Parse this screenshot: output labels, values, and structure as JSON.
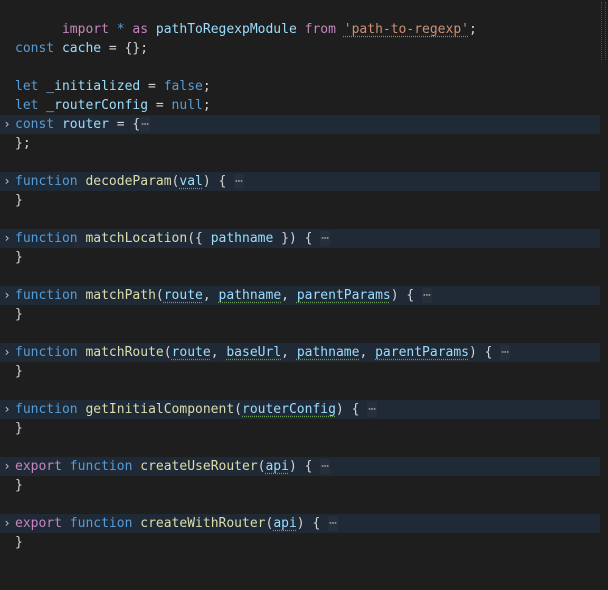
{
  "editor": {
    "lines": {
      "l1": {
        "kw_import": "import",
        "star": " * ",
        "kw_as": "as",
        "sp1": " ",
        "module_name": "pathToRegexpModule",
        "sp2": " ",
        "kw_from": "from",
        "sp3": " ",
        "string": "'path-to-regexp'",
        "semi": ";"
      },
      "l3": {
        "kw": "const",
        "name": " cache",
        "rest": " = {};"
      },
      "l5": {
        "kw": "let",
        "name": " _initialized",
        "eq": " = ",
        "val": "false",
        "semi": ";"
      },
      "l6": {
        "kw": "let",
        "name": " _routerConfig",
        "eq": " = ",
        "val": "null",
        "semi": ";"
      },
      "l7": {
        "kw": "const",
        "name": " router",
        "rest": " = {",
        "ellipsis": "⋯"
      },
      "l8": {
        "text": "};"
      },
      "l10": {
        "kw": "function",
        "name": "decodeParam",
        "open": "(",
        "p1": "val",
        "close": ") {",
        "ellipsis": "⋯"
      },
      "l11": {
        "text": "}"
      },
      "l13": {
        "kw": "function",
        "name": "matchLocation",
        "open": "({ ",
        "p1": "pathname",
        "close": " }) {",
        "ellipsis": "⋯"
      },
      "l14": {
        "text": "}"
      },
      "l16": {
        "kw": "function",
        "name": "matchPath",
        "open": "(",
        "p1": "route",
        "c1": ", ",
        "p2": "pathname",
        "c2": ", ",
        "p3": "parentParams",
        "close": ") {",
        "ellipsis": "⋯"
      },
      "l17": {
        "text": "}"
      },
      "l19": {
        "kw": "function",
        "name": "matchRoute",
        "open": "(",
        "p1": "route",
        "c1": ", ",
        "p2": "baseUrl",
        "c2": ", ",
        "p3": "pathname",
        "c3": ", ",
        "p4": "parentParams",
        "close": ") {",
        "ellipsis": "⋯"
      },
      "l20": {
        "text": "}"
      },
      "l22": {
        "kw": "function",
        "name": "getInitialComponent",
        "open": "(",
        "p1": "routerConfig",
        "close": ") {",
        "ellipsis": "⋯"
      },
      "l23": {
        "text": "}"
      },
      "l25": {
        "kw_export": "export",
        "kw": "function",
        "name": "createUseRouter",
        "open": "(",
        "p1": "api",
        "close": ") {",
        "ellipsis": "⋯"
      },
      "l26": {
        "text": "}"
      },
      "l28": {
        "kw_export": "export",
        "kw": "function",
        "name": "createWithRouter",
        "open": "(",
        "p1": "api",
        "close": ") {",
        "ellipsis": "⋯"
      },
      "l29": {
        "text": "}"
      }
    },
    "fold_icon": "chevron-right-icon",
    "fold_glyph": "›",
    "colors": {
      "background": "#1e1e1e",
      "folded_line": "#1f2a36",
      "keyword": "#569cd6",
      "control_keyword": "#c586c0",
      "function": "#dcdcaa",
      "variable": "#9cdcfe",
      "string": "#ce9178"
    }
  }
}
